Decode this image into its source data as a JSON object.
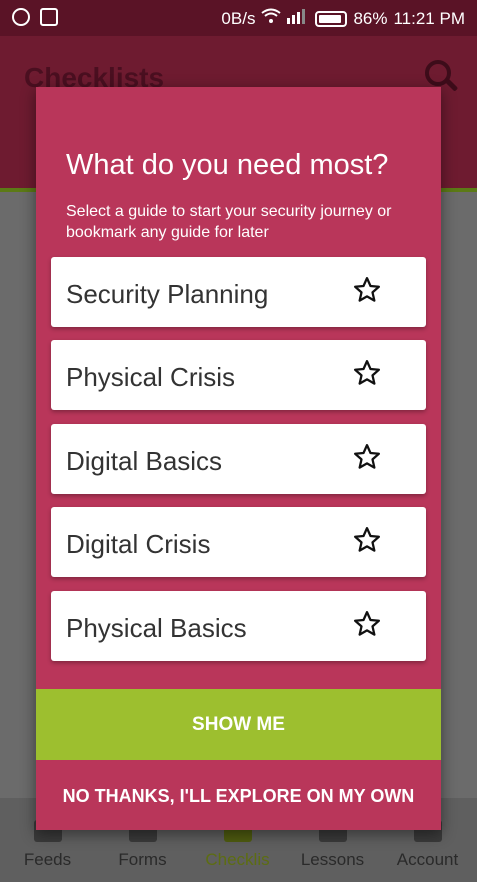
{
  "status_bar": {
    "left_icons": [
      "whatsapp-icon",
      "image-icon"
    ],
    "data_rate": "0B/s",
    "battery": "86%",
    "time": "11:21 PM"
  },
  "app_bar": {
    "title": "Checklists",
    "search_icon": "search-icon"
  },
  "dialog": {
    "heading": "What do you need most?",
    "subtitle": "Select a guide to start your security journey or bookmark any guide for later",
    "guides": [
      {
        "label": "Security Planning",
        "bookmark_icon": "star-outline-icon"
      },
      {
        "label": "Physical Crisis",
        "bookmark_icon": "star-outline-icon"
      },
      {
        "label": "Digital Basics",
        "bookmark_icon": "star-outline-icon"
      },
      {
        "label": "Digital Crisis",
        "bookmark_icon": "star-outline-icon"
      },
      {
        "label": "Physical Basics",
        "bookmark_icon": "star-outline-icon"
      }
    ],
    "primary_button": "SHOW ME",
    "secondary_button": "NO THANKS, I'LL EXPLORE ON MY OWN"
  },
  "bottom_nav": {
    "items": [
      {
        "label": "Feeds",
        "icon": "feeds-icon"
      },
      {
        "label": "Forms",
        "icon": "forms-icon"
      },
      {
        "label": "Checklis",
        "icon": "checklist-icon",
        "active": true
      },
      {
        "label": "Lessons",
        "icon": "lessons-icon"
      },
      {
        "label": "Account",
        "icon": "account-icon"
      }
    ]
  },
  "colors": {
    "dialog_background": "#b9365a",
    "primary_button": "#9dbf2f",
    "active_nav": "#5d6d12"
  }
}
